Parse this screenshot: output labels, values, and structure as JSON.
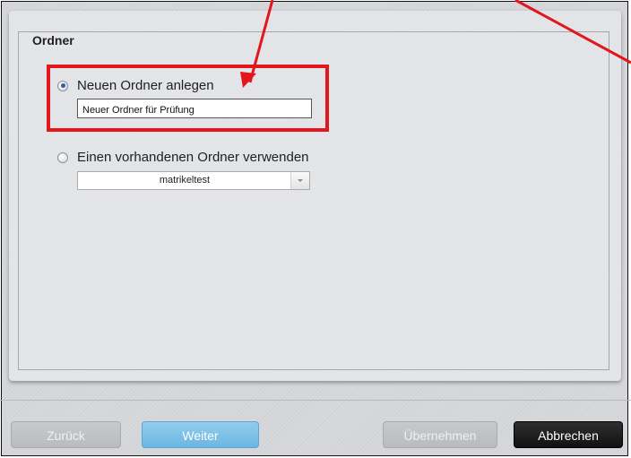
{
  "section": {
    "legend": "Ordner"
  },
  "options": {
    "new_folder_label": "Neuen Ordner anlegen",
    "new_folder_checked": true,
    "new_folder_name": "Neuer Ordner für Prüfung",
    "existing_folder_label": "Einen vorhandenen Ordner verwenden",
    "existing_folder_checked": false,
    "existing_folder_selected": "matrikeltest"
  },
  "footer": {
    "back_label": "Zurück",
    "next_label": "Weiter",
    "apply_label": "Übernehmen",
    "cancel_label": "Abbrechen"
  },
  "colors": {
    "annotation": "#e2161b",
    "primary_button": "#7bbfe5",
    "cancel_button": "#1b1b1b"
  },
  "icons": {
    "radio_checked": "radio-checked-icon",
    "radio_unchecked": "radio-unchecked-icon",
    "dropdown": "chevron-down-icon",
    "annotation_arrow": "red-arrow-icon"
  }
}
